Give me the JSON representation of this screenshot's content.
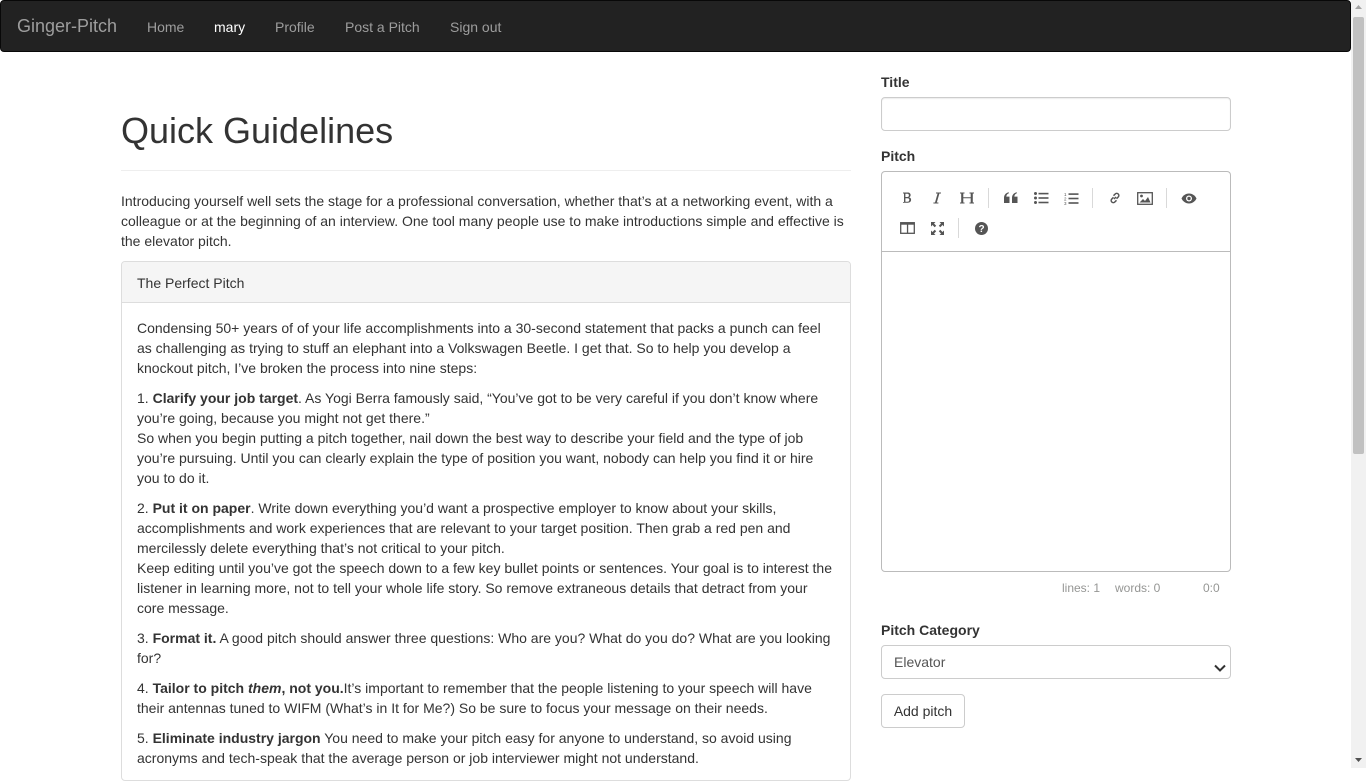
{
  "navbar": {
    "brand": "Ginger-Pitch",
    "items": [
      {
        "label": "Home",
        "active": false
      },
      {
        "label": "mary",
        "active": true
      },
      {
        "label": "Profile",
        "active": false
      },
      {
        "label": "Post a Pitch",
        "active": false
      },
      {
        "label": "Sign out",
        "active": false
      }
    ]
  },
  "main": {
    "title": "Quick Guidelines",
    "intro": "Introducing yourself well sets the stage for a professional conversation, whether that’s at a networking event, with a colleague or at the beginning of an interview. One tool many people use to make introductions simple and effective is the elevator pitch.",
    "panel": {
      "heading": "The Perfect Pitch",
      "intro": "Condensing 50+ years of of your life accomplishments into a 30-second statement that packs a punch can feel as challenging as trying to stuff an elephant into a Volkswagen Beetle. I get that. So to help you develop a knockout pitch, I’ve broken the process into nine steps:",
      "steps": [
        {
          "num": "1. ",
          "title": "Clarify your job target",
          "text": ". As Yogi Berra famously said, “You’ve got to be very careful if you don’t know where you’re going, because you might not get there.”",
          "text2": "So when you begin putting a pitch together, nail down the best way to describe your field and the type of job you’re pursuing. Until you can clearly explain the type of position you want, nobody can help you find it or hire you to do it."
        },
        {
          "num": "2. ",
          "title": "Put it on paper",
          "text": ". Write down everything you’d want a prospective employer to know about your skills, accomplishments and work experiences that are relevant to your target position. Then grab a red pen and mercilessly delete everything that’s not critical to your pitch.",
          "text2": "Keep editing until you’ve got the speech down to a few key bullet points or sentences. Your goal is to interest the listener in learning more, not to tell your whole life story. So remove extraneous details that detract from your core message."
        },
        {
          "num": "3. ",
          "title": "Format it.",
          "text": " A good pitch should answer three questions: Who are you? What do you do? What are you looking for?"
        },
        {
          "num": "4. ",
          "title_a": "Tailor to pitch ",
          "title_em": "them",
          "title_b": ", not you.",
          "text": "It’s important to remember that the people listening to your speech will have their antennas tuned to WIFM (What’s in It for Me?) So be sure to focus your message on their needs."
        },
        {
          "num": "5. ",
          "title": "Eliminate industry jargon",
          "text": " You need to make your pitch easy for anyone to understand, so avoid using acronyms and tech-speak that the average person or job interviewer might not understand."
        }
      ]
    }
  },
  "form": {
    "title_label": "Title",
    "title_value": "",
    "pitch_label": "Pitch",
    "toolbar": [
      "bold-icon",
      "italic-icon",
      "heading-icon",
      "quote-icon",
      "unordered-list-icon",
      "ordered-list-icon",
      "link-icon",
      "image-icon",
      "preview-icon",
      "side-by-side-icon",
      "fullscreen-icon",
      "help-icon"
    ],
    "status": {
      "lines": "lines: 1",
      "words": "words: 0",
      "cursor": "0:0"
    },
    "category_label": "Pitch Category",
    "category_value": "Elevator",
    "submit_label": "Add pitch"
  }
}
